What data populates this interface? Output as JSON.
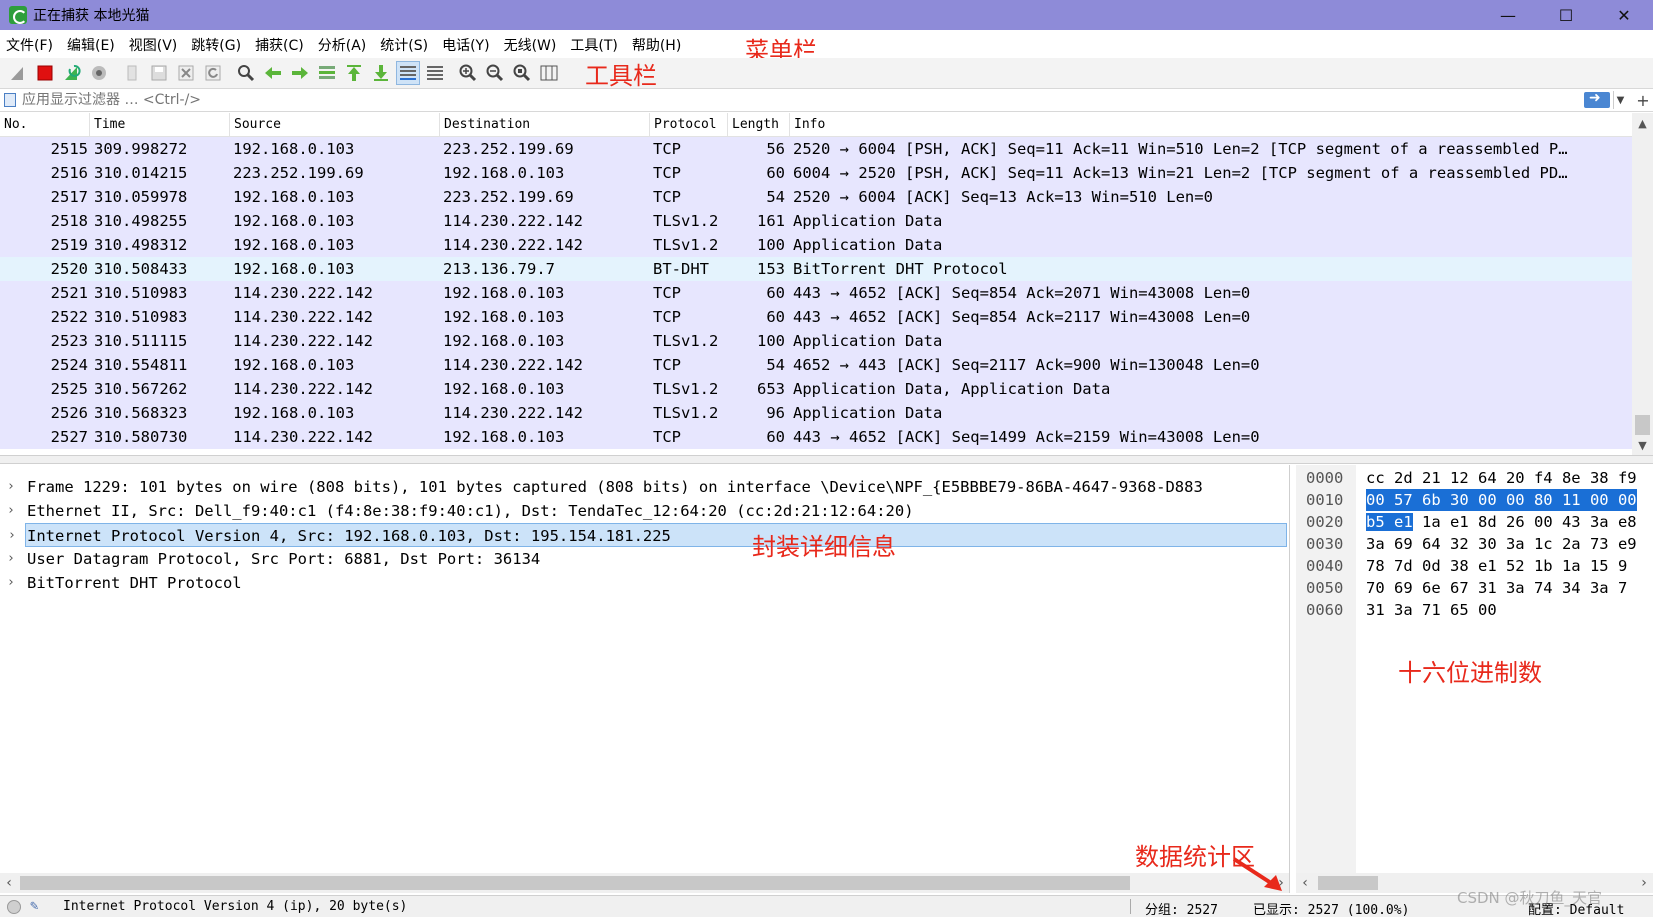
{
  "window": {
    "title": "正在捕获 本地光猫",
    "controls": {
      "minimize": "—",
      "maximize": "☐",
      "close": "✕"
    }
  },
  "menubar": {
    "items": [
      "文件(F)",
      "编辑(E)",
      "视图(V)",
      "跳转(G)",
      "捕获(C)",
      "分析(A)",
      "统计(S)",
      "电话(Y)",
      "无线(W)",
      "工具(T)",
      "帮助(H)"
    ]
  },
  "toolbar": {
    "icons": [
      "shark-fin-start-icon",
      "stop-capture-icon",
      "restart-capture-icon",
      "capture-options-icon",
      "open-file-icon",
      "save-file-icon",
      "close-file-icon",
      "reload-file-icon",
      "find-packet-icon",
      "go-back-icon",
      "go-forward-icon",
      "go-to-packet-icon",
      "first-packet-icon",
      "last-packet-icon",
      "autoscroll-icon",
      "colorize-icon",
      "zoom-in-icon",
      "zoom-out-icon",
      "zoom-normal-icon",
      "resize-columns-icon"
    ]
  },
  "annotations": {
    "menubar": "菜单栏",
    "toolbar": "工具栏",
    "details": "封装详细信息",
    "bytes": "十六位进制数",
    "stats": "数据统计区"
  },
  "filter": {
    "placeholder": "应用显示过滤器 … <Ctrl-/>"
  },
  "packet_list": {
    "columns": [
      "No.",
      "Time",
      "Source",
      "Destination",
      "Protocol",
      "Length",
      "Info"
    ],
    "rows": [
      {
        "no": "2515",
        "time": "309.998272",
        "src": "192.168.0.103",
        "dst": "223.252.199.69",
        "proto": "TCP",
        "len": "56",
        "info": "2520 → 6004 [PSH, ACK] Seq=11 Ack=11 Win=510 Len=2 [TCP segment of a reassembled P…"
      },
      {
        "no": "2516",
        "time": "310.014215",
        "src": "223.252.199.69",
        "dst": "192.168.0.103",
        "proto": "TCP",
        "len": "60",
        "info": "6004 → 2520 [PSH, ACK] Seq=11 Ack=13 Win=21 Len=2 [TCP segment of a reassembled PD…"
      },
      {
        "no": "2517",
        "time": "310.059978",
        "src": "192.168.0.103",
        "dst": "223.252.199.69",
        "proto": "TCP",
        "len": "54",
        "info": "2520 → 6004 [ACK] Seq=13 Ack=13 Win=510 Len=0"
      },
      {
        "no": "2518",
        "time": "310.498255",
        "src": "192.168.0.103",
        "dst": "114.230.222.142",
        "proto": "TLSv1.2",
        "len": "161",
        "info": "Application Data"
      },
      {
        "no": "2519",
        "time": "310.498312",
        "src": "192.168.0.103",
        "dst": "114.230.222.142",
        "proto": "TLSv1.2",
        "len": "100",
        "info": "Application Data"
      },
      {
        "no": "2520",
        "time": "310.508433",
        "src": "192.168.0.103",
        "dst": "213.136.79.7",
        "proto": "BT-DHT",
        "len": "153",
        "info": "BitTorrent DHT Protocol"
      },
      {
        "no": "2521",
        "time": "310.510983",
        "src": "114.230.222.142",
        "dst": "192.168.0.103",
        "proto": "TCP",
        "len": "60",
        "info": "443 → 4652 [ACK] Seq=854 Ack=2071 Win=43008 Len=0"
      },
      {
        "no": "2522",
        "time": "310.510983",
        "src": "114.230.222.142",
        "dst": "192.168.0.103",
        "proto": "TCP",
        "len": "60",
        "info": "443 → 4652 [ACK] Seq=854 Ack=2117 Win=43008 Len=0"
      },
      {
        "no": "2523",
        "time": "310.511115",
        "src": "114.230.222.142",
        "dst": "192.168.0.103",
        "proto": "TLSv1.2",
        "len": "100",
        "info": "Application Data"
      },
      {
        "no": "2524",
        "time": "310.554811",
        "src": "192.168.0.103",
        "dst": "114.230.222.142",
        "proto": "TCP",
        "len": "54",
        "info": "4652 → 443 [ACK] Seq=2117 Ack=900 Win=130048 Len=0"
      },
      {
        "no": "2525",
        "time": "310.567262",
        "src": "114.230.222.142",
        "dst": "192.168.0.103",
        "proto": "TLSv1.2",
        "len": "653",
        "info": "Application Data, Application Data"
      },
      {
        "no": "2526",
        "time": "310.568323",
        "src": "192.168.0.103",
        "dst": "114.230.222.142",
        "proto": "TLSv1.2",
        "len": "96",
        "info": "Application Data"
      },
      {
        "no": "2527",
        "time": "310.580730",
        "src": "114.230.222.142",
        "dst": "192.168.0.103",
        "proto": "TCP",
        "len": "60",
        "info": "443 → 4652 [ACK] Seq=1499 Ack=2159 Win=43008 Len=0"
      }
    ]
  },
  "details": {
    "rows": [
      "Frame 1229: 101 bytes on wire (808 bits), 101 bytes captured (808 bits) on interface \\Device\\NPF_{E5BBBE79-86BA-4647-9368-D883",
      "Ethernet II, Src: Dell_f9:40:c1 (f4:8e:38:f9:40:c1), Dst: TendaTec_12:64:20 (cc:2d:21:12:64:20)",
      "Internet Protocol Version 4, Src: 192.168.0.103, Dst: 195.154.181.225",
      "User Datagram Protocol, Src Port: 6881, Dst Port: 36134",
      "BitTorrent DHT Protocol"
    ],
    "selected_index": 2
  },
  "bytes": {
    "rows": [
      {
        "offset": "0000",
        "hex": "cc 2d 21 12 64 20 f4 8e  38 f9",
        "hl": ""
      },
      {
        "offset": "0010",
        "hex": "",
        "hl": "00 57 6b 30 00 00 80 11  00 00"
      },
      {
        "offset": "0020",
        "hex": " 1a e1 8d 26 00 43  3a e8",
        "hl": "b5 e1"
      },
      {
        "offset": "0030",
        "hex": "3a 69 64 32 30 3a 1c 2a  73 e9",
        "hl": ""
      },
      {
        "offset": "0040",
        "hex": "78 7d 0d 38 e1 52 1b 1a  15 9",
        "hl": ""
      },
      {
        "offset": "0050",
        "hex": "70 69 6e 67 31 3a 74 34  3a 7",
        "hl": ""
      },
      {
        "offset": "0060",
        "hex": "31 3a 71 65 00",
        "hl": ""
      }
    ]
  },
  "statusbar": {
    "message": "Internet Protocol Version 4 (ip), 20 byte(s)",
    "packets": "分组: 2527",
    "displayed": "已显示: 2527 (100.0%)",
    "profile": "配置: Default"
  },
  "watermark": "CSDN @秋刀鱼_天官"
}
